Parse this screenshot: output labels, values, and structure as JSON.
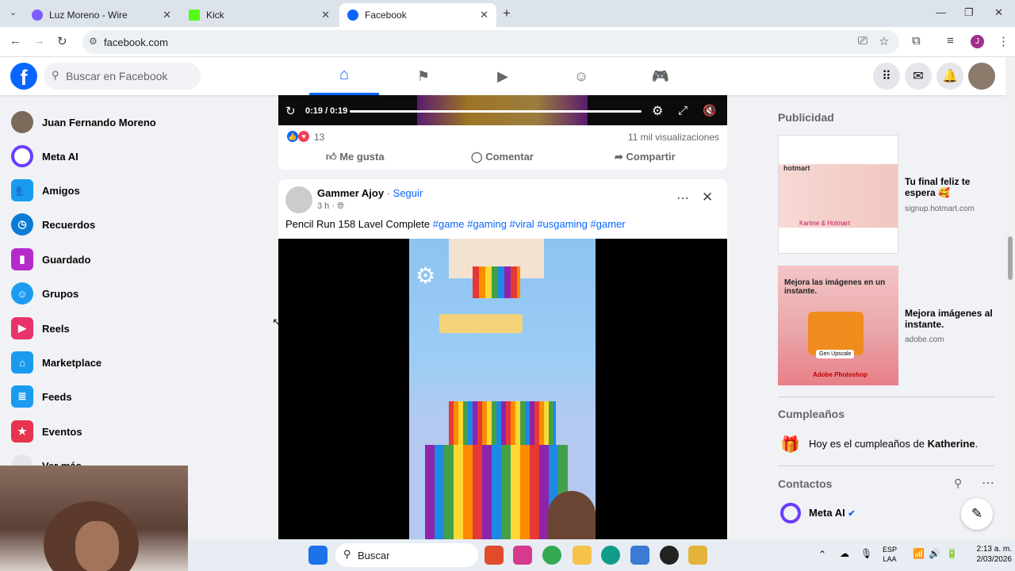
{
  "browser": {
    "tabs": [
      {
        "label": "Luz Moreno - Wire"
      },
      {
        "label": "Kick"
      },
      {
        "label": "Facebook"
      }
    ],
    "url": "facebook.com",
    "profile_initial": "J"
  },
  "fb": {
    "search_placeholder": "Buscar en Facebook",
    "sidebar": [
      {
        "label": "Juan Fernando Moreno"
      },
      {
        "label": "Meta AI"
      },
      {
        "label": "Amigos"
      },
      {
        "label": "Recuerdos"
      },
      {
        "label": "Guardado"
      },
      {
        "label": "Grupos"
      },
      {
        "label": "Reels"
      },
      {
        "label": "Marketplace"
      },
      {
        "label": "Feeds"
      },
      {
        "label": "Eventos"
      },
      {
        "label": "Ver más"
      }
    ],
    "video1": {
      "time": "0:19 / 0:19",
      "reactions": "13",
      "views": "11 mil visualizaciones",
      "like": "Me gusta",
      "comment": "Comentar",
      "share": "Compartir"
    },
    "post2": {
      "author": "Gammer Ajoy",
      "follow": "Seguir",
      "time": "3 h",
      "text": "Pencil Run 158 Lavel Complete",
      "hashtags": [
        "#game",
        "#gaming",
        "#viral",
        "#usgaming",
        "#gamer"
      ]
    },
    "right": {
      "ads_title": "Publicidad",
      "ads": [
        {
          "title": "Tu final feliz te espera 🥰",
          "domain": "signup.hotmart.com",
          "brand": "hotmart",
          "caption": "Karime & Hotmart"
        },
        {
          "title": "Mejora imágenes al instante.",
          "domain": "adobe.com",
          "headline": "Mejora las imágenes en un instante.",
          "button": "Gen Upscale",
          "brand": "Adobe Photoshop"
        }
      ],
      "birthdays_title": "Cumpleaños",
      "birthday_prefix": "Hoy es el cumpleaños de ",
      "birthday_name": "Katherine",
      "contacts_title": "Contactos",
      "contact": "Meta AI"
    }
  },
  "taskbar": {
    "search": "Buscar",
    "lang1": "ESP",
    "lang2": "LAA",
    "time": "2:13 a. m.",
    "date": "2/03/2026"
  }
}
